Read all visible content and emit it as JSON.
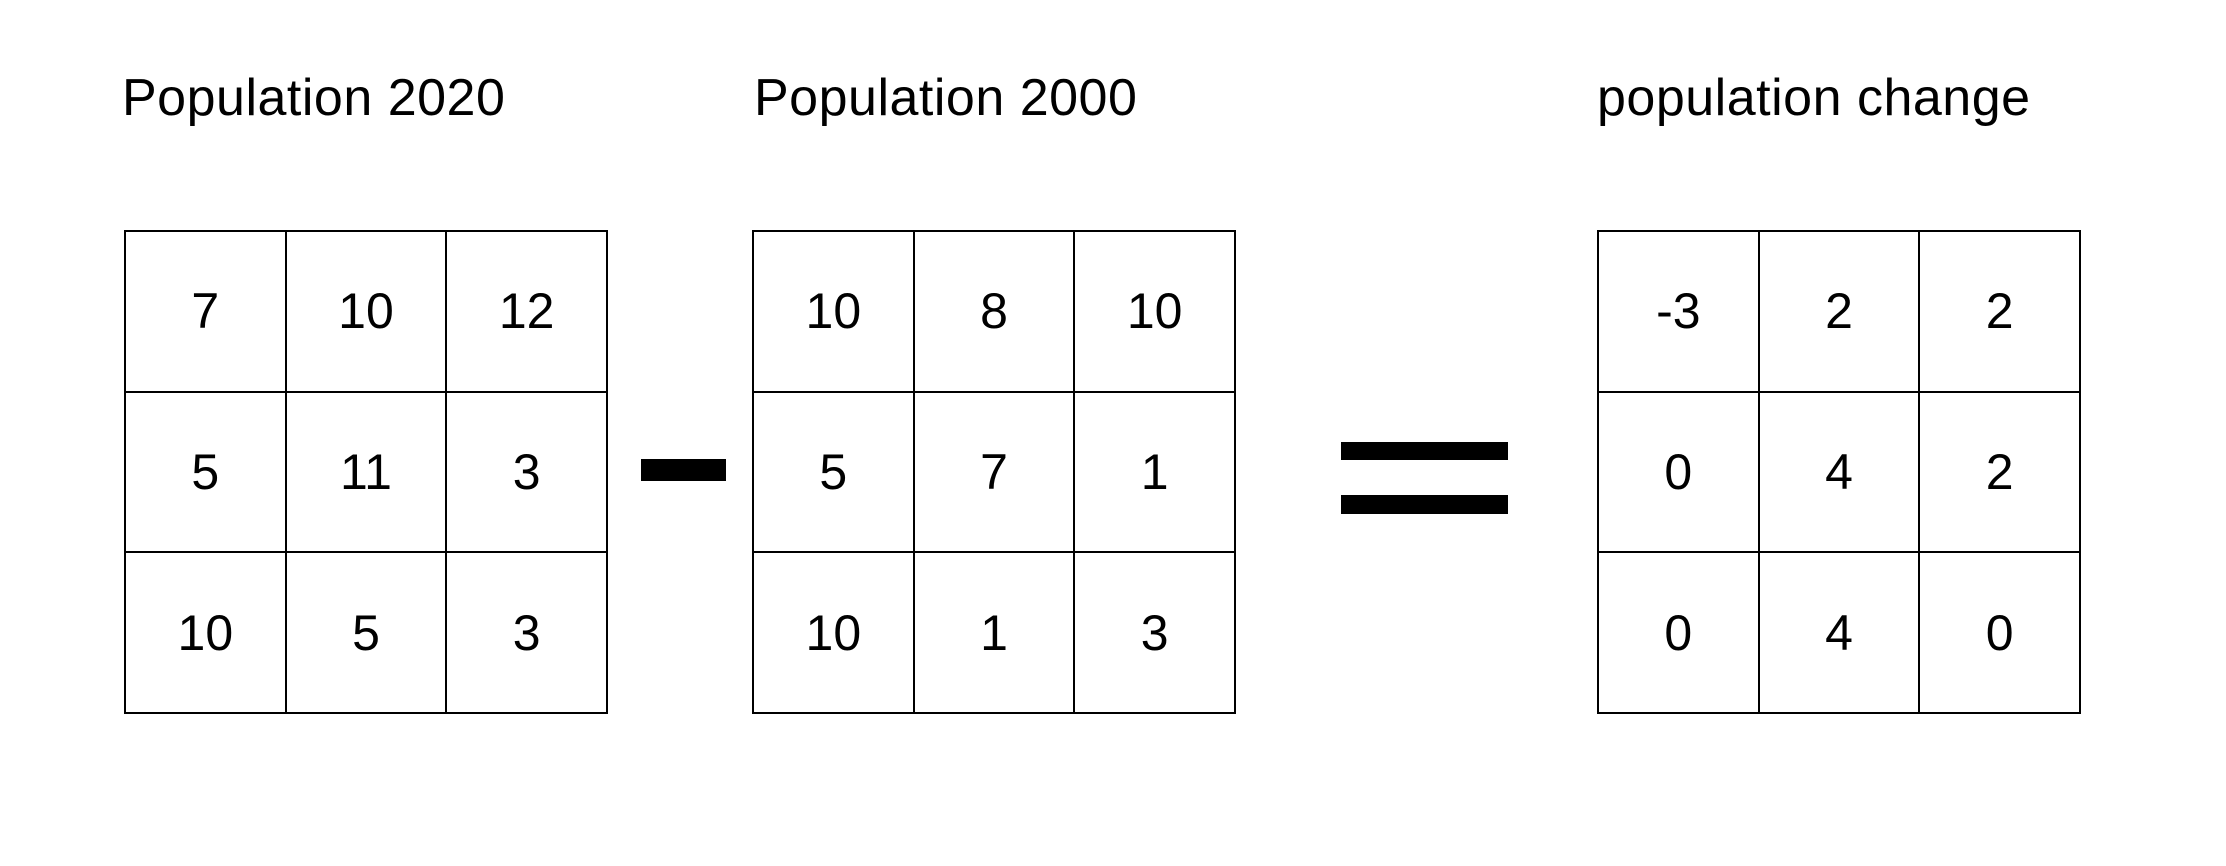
{
  "matrices": [
    {
      "title": "Population 2020",
      "values": [
        [
          7,
          10,
          12
        ],
        [
          5,
          11,
          3
        ],
        [
          10,
          5,
          3
        ]
      ]
    },
    {
      "title": "Population 2000",
      "values": [
        [
          10,
          8,
          10
        ],
        [
          5,
          7,
          1
        ],
        [
          10,
          1,
          3
        ]
      ]
    },
    {
      "title": "population change",
      "values": [
        [
          -3,
          2,
          2
        ],
        [
          0,
          4,
          2
        ],
        [
          0,
          4,
          0
        ]
      ]
    }
  ],
  "operators": [
    "minus",
    "equals"
  ]
}
